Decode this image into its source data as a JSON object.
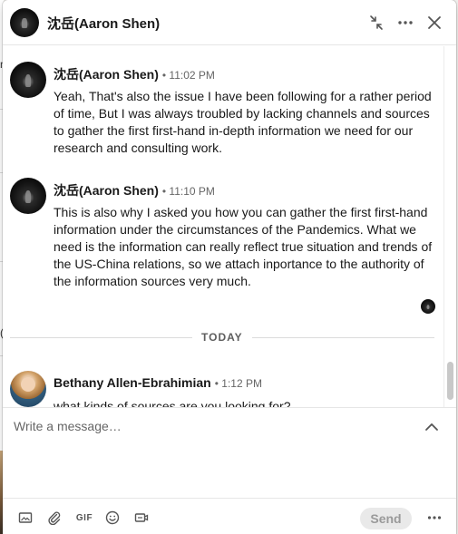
{
  "window": {
    "title": "沈岳(Aaron Shen)"
  },
  "messages": [
    {
      "sender": "沈岳(Aaron Shen)",
      "time": "• 11:02 PM",
      "text": "Yeah, That's also the issue I have been following for a rather period of time, But I was always troubled by lacking channels and sources to gather the first first-hand in-depth information we need for our research and consulting work."
    },
    {
      "sender": "沈岳(Aaron Shen)",
      "time": "• 11:10 PM",
      "text": "This is also why I asked you how you can gather the first first-hand information under the circumstances of the Pandemics. What we need is the information can really reflect true situation and trends of the US-China relations, so we attach inportance to the authority of the information sources very much."
    },
    {
      "sender": "Bethany Allen-Ebrahimian",
      "time": "• 1:12 PM",
      "text": "what kinds of sources are you looking for?"
    }
  ],
  "day_divider": "TODAY",
  "composer": {
    "placeholder": "Write a message…"
  },
  "toolbar": {
    "gif_label": "GIF",
    "send_label": "Send"
  },
  "background": {
    "fragment_1": "n",
    "fragment_2": "("
  },
  "colors": {
    "send_disabled_bg": "#e9e9e9",
    "text_primary": "#191919",
    "text_secondary": "#666666"
  }
}
